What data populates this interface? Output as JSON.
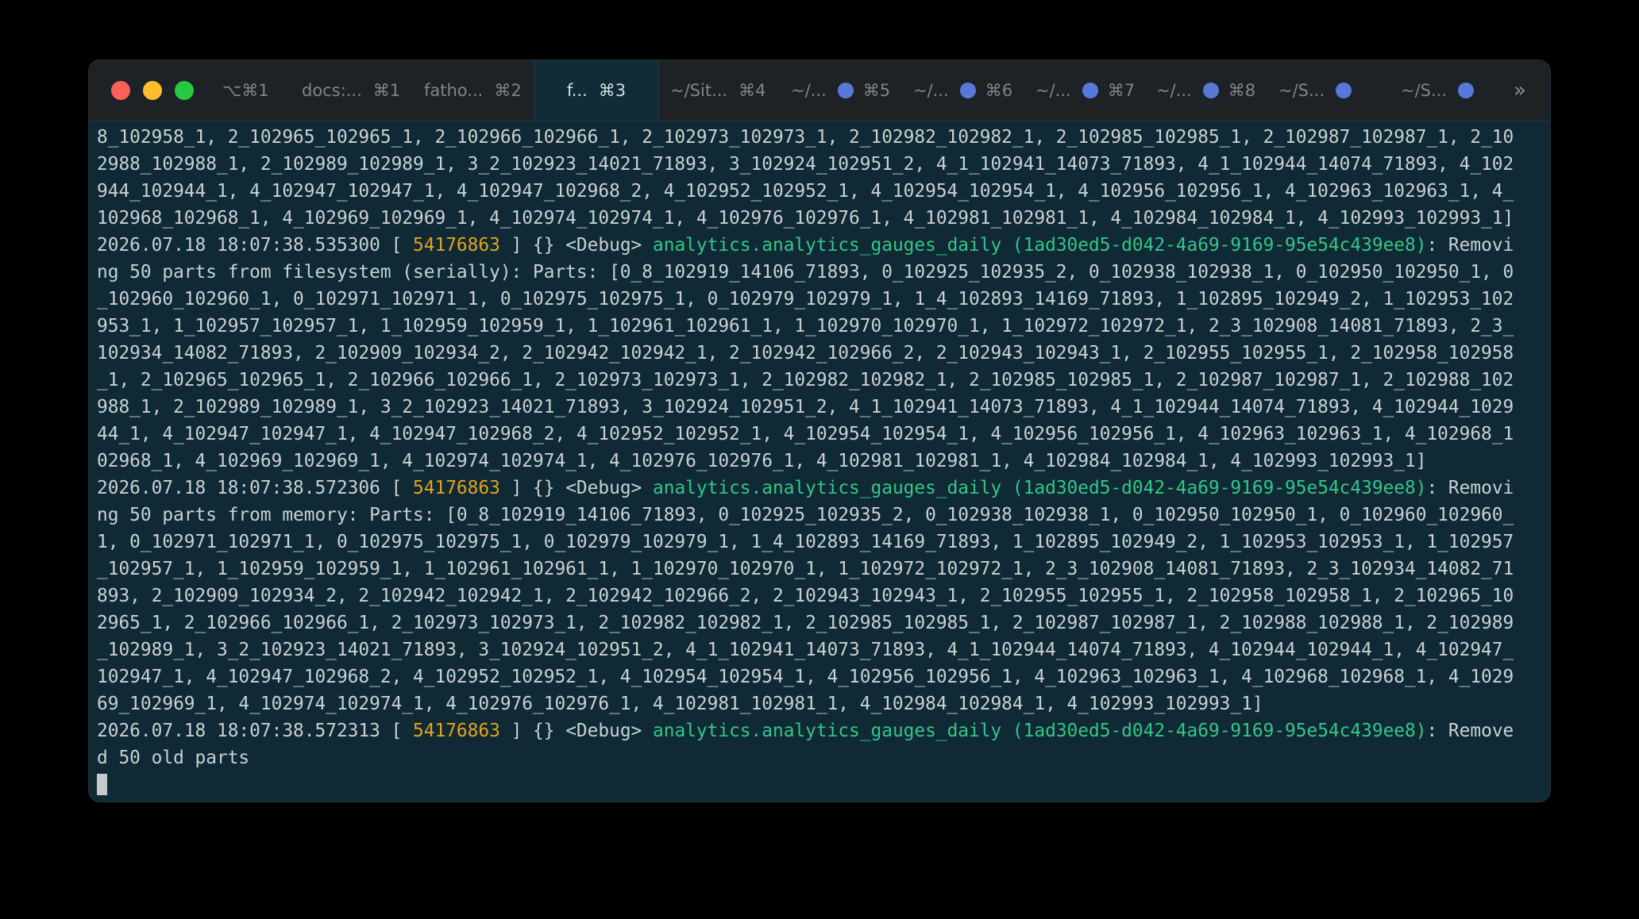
{
  "window": {
    "traffic_lights": [
      "close",
      "minimize",
      "zoom"
    ],
    "colors": {
      "background": "#0f2a35",
      "titlebar": "#1c2225",
      "thread_id": "#e4a31b",
      "logger": "#33c68a",
      "activity_dot": "#5a78d9"
    }
  },
  "tabs": [
    {
      "title": "⌥⌘1",
      "shortcut": ""
    },
    {
      "title": "docs:...",
      "shortcut": "⌘1"
    },
    {
      "title": "fatho...",
      "shortcut": "⌘2"
    },
    {
      "title": "f...",
      "shortcut": "⌘3"
    },
    {
      "title": "~/Sit...",
      "shortcut": "⌘4"
    },
    {
      "title": "~/...",
      "shortcut": "⌘5"
    },
    {
      "title": "~/...",
      "shortcut": "⌘6"
    },
    {
      "title": "~/...",
      "shortcut": "⌘7"
    },
    {
      "title": "~/...",
      "shortcut": "⌘8"
    },
    {
      "title": "~/S...",
      "shortcut": ""
    },
    {
      "title": "~/S...",
      "shortcut": ""
    }
  ],
  "overflow_icon": "»",
  "terminal": {
    "lines": [
      [
        "8_102958_1, 2_102965_102965_1, 2_102966_102966_1, 2_102973_102973_1, 2_102982_102982_1, 2_102985_102985_1, 2_102987_102987_1, 2_10"
      ],
      [
        "2988_102988_1, 2_102989_102989_1, 3_2_102923_14021_71893, 3_102924_102951_2, 4_1_102941_14073_71893, 4_1_102944_14074_71893, 4_102"
      ],
      [
        "944_102944_1, 4_102947_102947_1, 4_102947_102968_2, 4_102952_102952_1, 4_102954_102954_1, 4_102956_102956_1, 4_102963_102963_1, 4_"
      ],
      [
        "102968_102968_1, 4_102969_102969_1, 4_102974_102974_1, 4_102976_102976_1, 4_102981_102981_1, 4_102984_102984_1, 4_102993_102993_1]"
      ],
      [
        "2026.07.18 18:07:38.535300 [ ",
        "54176863",
        " ] {} <Debug> ",
        "analytics.analytics_gauges_daily (1ad30ed5-d042-4a69-9169-95e54c439ee8)",
        ": Removi"
      ],
      [
        "ng 50 parts from filesystem (serially): Parts: [0_8_102919_14106_71893, 0_102925_102935_2, 0_102938_102938_1, 0_102950_102950_1, 0"
      ],
      [
        "_102960_102960_1, 0_102971_102971_1, 0_102975_102975_1, 0_102979_102979_1, 1_4_102893_14169_71893, 1_102895_102949_2, 1_102953_102"
      ],
      [
        "953_1, 1_102957_102957_1, 1_102959_102959_1, 1_102961_102961_1, 1_102970_102970_1, 1_102972_102972_1, 2_3_102908_14081_71893, 2_3_"
      ],
      [
        "102934_14082_71893, 2_102909_102934_2, 2_102942_102942_1, 2_102942_102966_2, 2_102943_102943_1, 2_102955_102955_1, 2_102958_102958"
      ],
      [
        "_1, 2_102965_102965_1, 2_102966_102966_1, 2_102973_102973_1, 2_102982_102982_1, 2_102985_102985_1, 2_102987_102987_1, 2_102988_102"
      ],
      [
        "988_1, 2_102989_102989_1, 3_2_102923_14021_71893, 3_102924_102951_2, 4_1_102941_14073_71893, 4_1_102944_14074_71893, 4_102944_1029"
      ],
      [
        "44_1, 4_102947_102947_1, 4_102947_102968_2, 4_102952_102952_1, 4_102954_102954_1, 4_102956_102956_1, 4_102963_102963_1, 4_102968_1"
      ],
      [
        "02968_1, 4_102969_102969_1, 4_102974_102974_1, 4_102976_102976_1, 4_102981_102981_1, 4_102984_102984_1, 4_102993_102993_1]"
      ],
      [
        "2026.07.18 18:07:38.572306 [ ",
        "54176863",
        " ] {} <Debug> ",
        "analytics.analytics_gauges_daily (1ad30ed5-d042-4a69-9169-95e54c439ee8)",
        ": Removi"
      ],
      [
        "ng 50 parts from memory: Parts: [0_8_102919_14106_71893, 0_102925_102935_2, 0_102938_102938_1, 0_102950_102950_1, 0_102960_102960_"
      ],
      [
        "1, 0_102971_102971_1, 0_102975_102975_1, 0_102979_102979_1, 1_4_102893_14169_71893, 1_102895_102949_2, 1_102953_102953_1, 1_102957"
      ],
      [
        "_102957_1, 1_102959_102959_1, 1_102961_102961_1, 1_102970_102970_1, 1_102972_102972_1, 2_3_102908_14081_71893, 2_3_102934_14082_71"
      ],
      [
        "893, 2_102909_102934_2, 2_102942_102942_1, 2_102942_102966_2, 2_102943_102943_1, 2_102955_102955_1, 2_102958_102958_1, 2_102965_10"
      ],
      [
        "2965_1, 2_102966_102966_1, 2_102973_102973_1, 2_102982_102982_1, 2_102985_102985_1, 2_102987_102987_1, 2_102988_102988_1, 2_102989"
      ],
      [
        "_102989_1, 3_2_102923_14021_71893, 3_102924_102951_2, 4_1_102941_14073_71893, 4_1_102944_14074_71893, 4_102944_102944_1, 4_102947_"
      ],
      [
        "102947_1, 4_102947_102968_2, 4_102952_102952_1, 4_102954_102954_1, 4_102956_102956_1, 4_102963_102963_1, 4_102968_102968_1, 4_1029"
      ],
      [
        "69_102969_1, 4_102974_102974_1, 4_102976_102976_1, 4_102981_102981_1, 4_102984_102984_1, 4_102993_102993_1]"
      ],
      [
        "2026.07.18 18:07:38.572313 [ ",
        "54176863",
        " ] {} <Debug> ",
        "analytics.analytics_gauges_daily (1ad30ed5-d042-4a69-9169-95e54c439ee8)",
        ": Remove"
      ],
      [
        "d 50 old parts"
      ]
    ]
  }
}
